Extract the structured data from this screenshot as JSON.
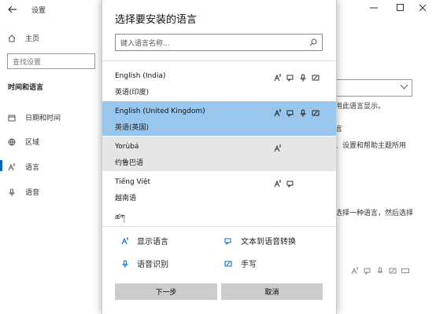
{
  "settings": {
    "title": "设置",
    "home_label": "主页",
    "search_placeholder": "查找设置",
    "section_title": "时间和语言",
    "nav_items": [
      {
        "label": "日期和时间",
        "icon": "calendar-icon"
      },
      {
        "label": "区域",
        "icon": "globe-icon"
      },
      {
        "label": "语言",
        "icon": "language-icon"
      },
      {
        "label": "语音",
        "icon": "microphone-icon"
      }
    ],
    "right_texts": {
      "line1": "用此语言显示。",
      "line2": "言",
      "line3": "、设置和帮助主题所用",
      "line4": "选择一种语言，然后选择"
    }
  },
  "dialog": {
    "title": "选择要安装的语言",
    "search_placeholder": "键入语言名称...",
    "languages": [
      {
        "name": "English (India)",
        "native": "英语(印度)",
        "features": [
          "display",
          "tts",
          "speech",
          "handwriting"
        ],
        "state": "normal"
      },
      {
        "name": "English (United Kingdom)",
        "native": "英语(英国)",
        "features": [
          "display",
          "tts",
          "speech",
          "handwriting"
        ],
        "state": "selected"
      },
      {
        "name": "Yorùbá",
        "native": "约鲁巴语",
        "features": [
          "display"
        ],
        "state": "hover"
      },
      {
        "name": "Tiếng Việt",
        "native": "越南语",
        "features": [
          "display",
          "tts"
        ],
        "state": "normal"
      },
      {
        "name": "ཚཀ",
        "native": "",
        "features": [],
        "state": "normal"
      }
    ],
    "legend": {
      "display": "显示语言",
      "tts": "文本到语音转换",
      "speech": "语音识别",
      "handwriting": "手写"
    },
    "next_button": "下一步",
    "cancel_button": "取消"
  },
  "colors": {
    "selected_row": "#99c6ec",
    "hover_row": "#e6e6e6",
    "button_bg": "#cccccc",
    "accent": "#0067c0"
  }
}
